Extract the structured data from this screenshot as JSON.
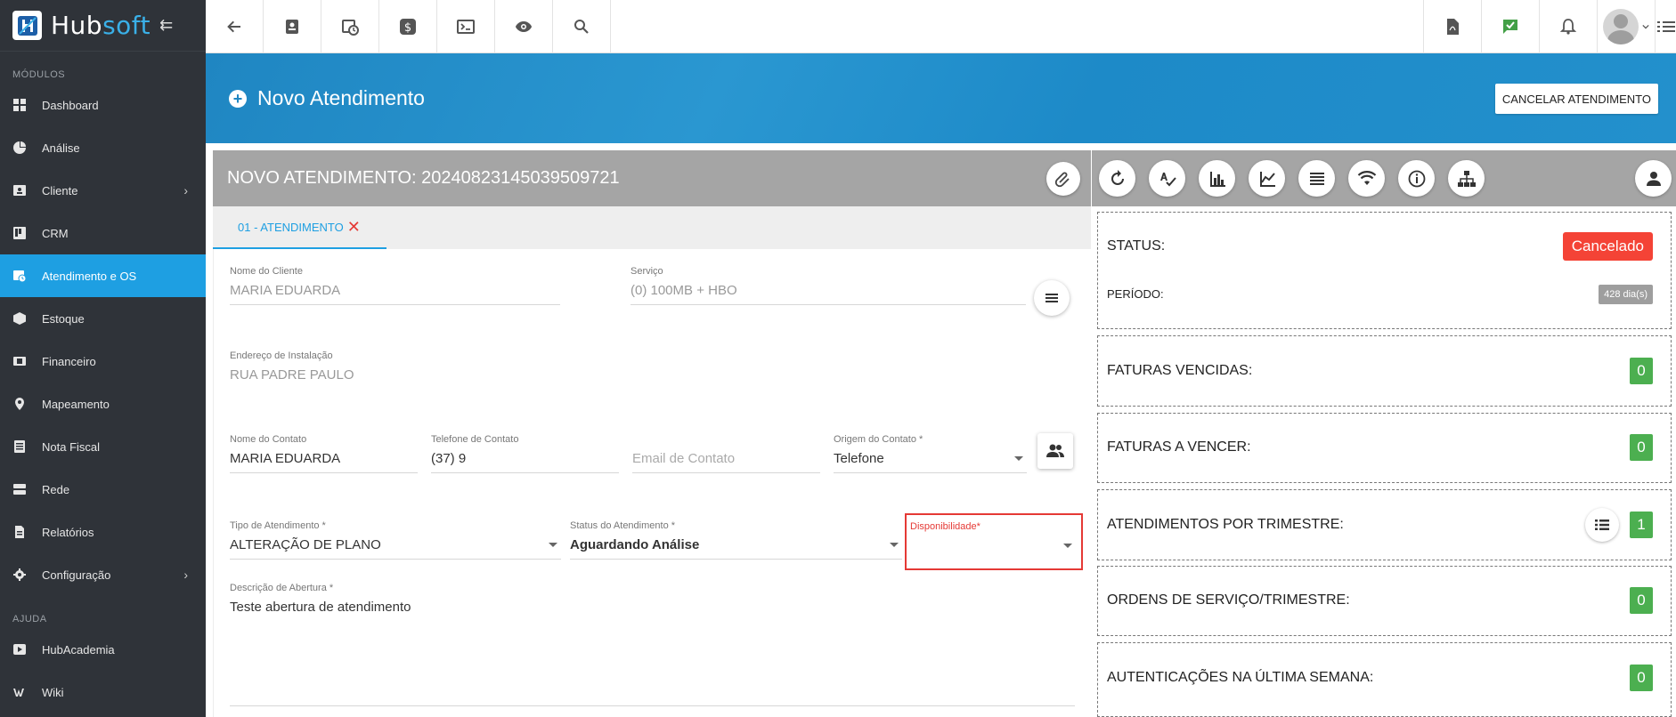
{
  "brand": {
    "name_part1": "Hub",
    "name_part2": "soft",
    "collapse_icon": "arrow-collapse-icon"
  },
  "sidebar": {
    "section_modules": "MÓDULOS",
    "items": [
      {
        "label": "Dashboard",
        "icon": "dashboard-icon"
      },
      {
        "label": "Análise",
        "icon": "pie-chart-icon"
      },
      {
        "label": "Cliente",
        "icon": "contact-card-icon",
        "has_chevron": true
      },
      {
        "label": "CRM",
        "icon": "kanban-icon"
      },
      {
        "label": "Atendimento e OS",
        "icon": "calendar-clock-icon",
        "active": true
      },
      {
        "label": "Estoque",
        "icon": "box-icon"
      },
      {
        "label": "Financeiro",
        "icon": "money-icon"
      },
      {
        "label": "Mapeamento",
        "icon": "map-pin-icon"
      },
      {
        "label": "Nota Fiscal",
        "icon": "invoice-icon"
      },
      {
        "label": "Rede",
        "icon": "server-icon"
      },
      {
        "label": "Relatórios",
        "icon": "report-icon"
      },
      {
        "label": "Configuração",
        "icon": "gear-icon",
        "has_chevron": true
      }
    ],
    "section_help": "AJUDA",
    "help_items": [
      {
        "label": "HubAcademia",
        "icon": "play-icon"
      },
      {
        "label": "Wiki",
        "icon": "wiki-icon"
      }
    ],
    "chevron": "›"
  },
  "header": {
    "title": "Novo Atendimento",
    "plus": "+",
    "cancel_label": "CANCELAR ATENDIMENTO"
  },
  "panel": {
    "title": "NOVO ATENDIMENTO: 20240823145039509721",
    "tab_label": "01 - ATENDIMENTO",
    "tab_close": "✕"
  },
  "form": {
    "cliente_label": "Nome do Cliente",
    "cliente_value": "MARIA EDUARDA",
    "servico_label": "Serviço",
    "servico_value": "(0) 100MB + HBO",
    "endereco_label": "Endereço de Instalação",
    "endereco_value": "RUA PADRE PAULO",
    "contato_label": "Nome do Contato",
    "contato_value": "MARIA EDUARDA",
    "telefone_label": "Telefone de Contato",
    "telefone_value": "(37) 9",
    "email_placeholder": "Email de Contato",
    "origem_label": "Origem do Contato *",
    "origem_value": "Telefone",
    "tipo_label": "Tipo de Atendimento *",
    "tipo_value": "ALTERAÇÃO DE PLANO",
    "status_label": "Status do Atendimento *",
    "status_value": "Aguardando Análise",
    "disp_label": "Disponibilidade*",
    "disp_value": "",
    "descricao_label": "Descrição de Abertura *",
    "descricao_value": "Teste abertura de atendimento"
  },
  "summary": {
    "status_label": "STATUS:",
    "status_value": "Cancelado",
    "periodo_label": "PERÍODO:",
    "periodo_value": "428 dia(s)",
    "faturas_vencidas_label": "FATURAS VENCIDAS:",
    "faturas_vencidas_value": "0",
    "faturas_vencer_label": "FATURAS A VENCER:",
    "faturas_vencer_value": "0",
    "atendimentos_label": "ATENDIMENTOS POR TRIMESTRE:",
    "atendimentos_value": "1",
    "ordens_label": "ORDENS DE SERVIÇO/TRIMESTRE:",
    "ordens_value": "0",
    "autenticacoes_label": "AUTENTICAÇÕES NA ÚLTIMA SEMANA:",
    "autenticacoes_value": "0"
  },
  "colors": {
    "accent": "#1e9fe2",
    "sidebar_bg": "#2f3339",
    "danger": "#f44336",
    "success": "#4caf50"
  }
}
